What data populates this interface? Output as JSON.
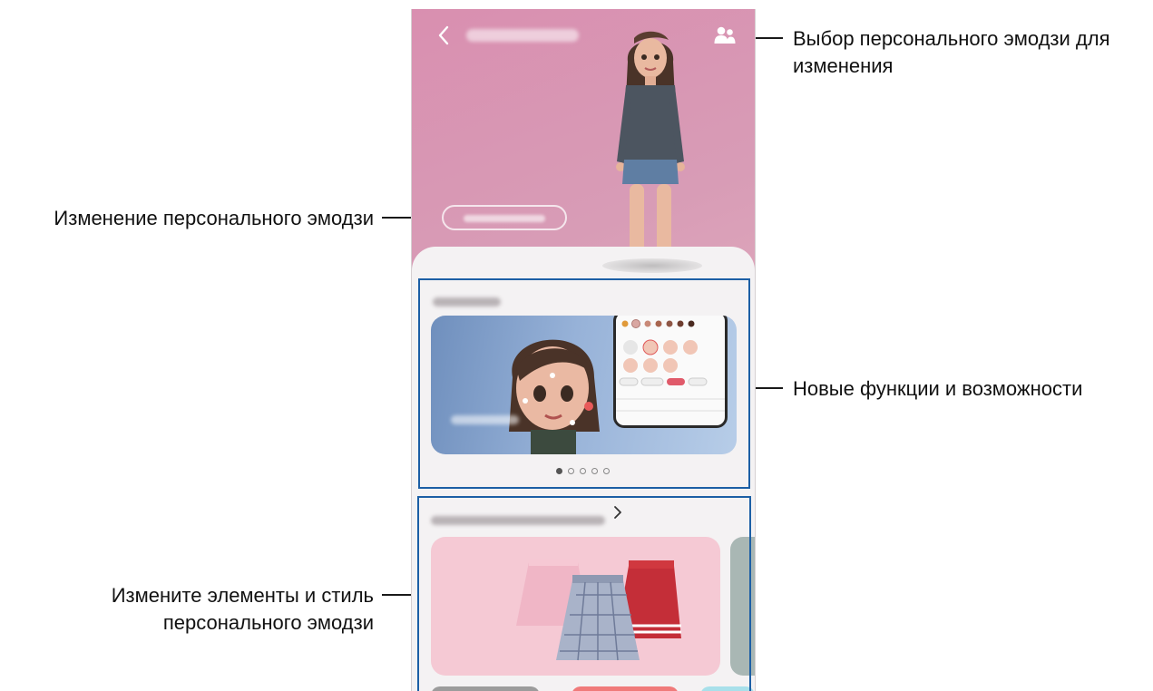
{
  "callouts": {
    "select_emoji": "Выбор персонального эмодзи для изменения",
    "edit_emoji": "Изменение персонального эмодзи",
    "new_features": "Новые функции и возможности",
    "change_items": "Измените элементы и стиль персонального эмодзи"
  },
  "app": {
    "back_icon": "chevron-left-icon",
    "select_icon": "people-icon"
  },
  "carousel": {
    "pages": 5,
    "active_index": 0
  },
  "colors": {
    "highlight_box": "#1c5fa5",
    "header_gradient_start": "#d98fb0",
    "header_gradient_end": "#ecc5cf"
  }
}
